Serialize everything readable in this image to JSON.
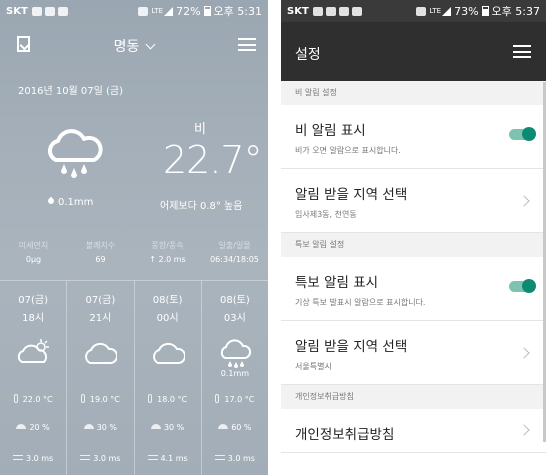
{
  "left": {
    "status": {
      "carrier": "SKT",
      "lte": "LTE",
      "battery": "72%",
      "time": "오후 5:31"
    },
    "location": "명동",
    "date": "2016년 10월 07일 (금)",
    "weather_desc": "비",
    "temperature": "22.7°",
    "precipitation": "0.1mm",
    "comparison": "어제보다 0.8° 높음",
    "stats": [
      {
        "label": "미세먼지",
        "value": "0μg"
      },
      {
        "label": "불쾌지수",
        "value": "69"
      },
      {
        "label": "풍향/풍속",
        "value": "↑ 2.0 ms"
      },
      {
        "label": "일출/일몰",
        "value": "06:34/18:05"
      }
    ],
    "forecast": [
      {
        "day": "07(금)",
        "hour": "18시",
        "icon": "partly-cloudy-icon",
        "precip": "",
        "temp": "22.0 °C",
        "pop": "20 %",
        "wind": "3.0 ms"
      },
      {
        "day": "07(금)",
        "hour": "21시",
        "icon": "cloud-icon",
        "precip": "",
        "temp": "19.0 °C",
        "pop": "30 %",
        "wind": "3.0 ms"
      },
      {
        "day": "08(토)",
        "hour": "00시",
        "icon": "cloud-icon",
        "precip": "",
        "temp": "18.0 °C",
        "pop": "30 %",
        "wind": "4.1 ms"
      },
      {
        "day": "08(토)",
        "hour": "03시",
        "icon": "rain-cloud-icon",
        "precip": "0.1mm",
        "temp": "17.0 °C",
        "pop": "60 %",
        "wind": "3.0 ms"
      }
    ]
  },
  "right": {
    "status": {
      "carrier": "SKT",
      "lte": "LTE",
      "battery": "73%",
      "time": "오후 5:37"
    },
    "title": "설정",
    "sections": {
      "rain_header": "비 알림 설정",
      "rain_toggle_title": "비 알림 표시",
      "rain_toggle_sub": "비가 오면 알람으로 표시합니다.",
      "rain_region_title": "알림 받을 지역 선택",
      "rain_region_sub": "임사제3동, 천연동",
      "special_header": "특보 알림 설정",
      "special_toggle_title": "특보 알림 표시",
      "special_toggle_sub": "기상 특보 발표시 알람으로 표시합니다.",
      "special_region_title": "알림 받을 지역 선택",
      "special_region_sub": "서울특별시",
      "privacy_header": "개인정보취급방침",
      "privacy_title": "개인정보취급방침"
    }
  },
  "colors": {
    "toggle_on": "#0e8a72",
    "header_dark": "#2f2f2f"
  }
}
